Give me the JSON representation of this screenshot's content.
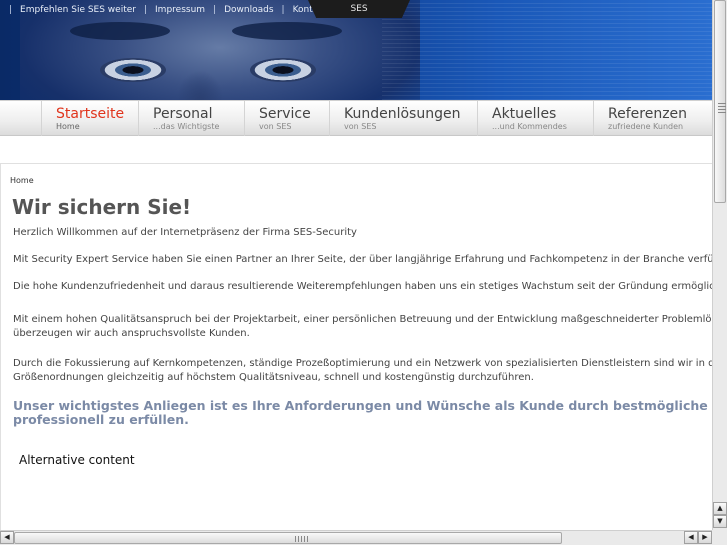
{
  "toplinks": {
    "sep": "|",
    "items": [
      "Empfehlen Sie SES weiter",
      "Impressum",
      "Downloads",
      "Kontakt"
    ]
  },
  "header": {
    "ses_tab": "SES"
  },
  "nav": [
    {
      "title": "Startseite",
      "sub": "Home",
      "active": true
    },
    {
      "title": "Personal",
      "sub": "...das Wichtigste"
    },
    {
      "title": "Service",
      "sub": "von SES"
    },
    {
      "title": "Kundenlösungen",
      "sub": "von SES"
    },
    {
      "title": "Aktuelles",
      "sub": "...und Kommendes"
    },
    {
      "title": "Referenzen",
      "sub": "zufriedene Kunden"
    }
  ],
  "content": {
    "breadcrumb": "Home",
    "title": "Wir sichern Sie!",
    "paragraphs": [
      "Herzlich Willkommen auf der Internetpräsenz der Firma SES-Security",
      "Mit Security Expert Service haben Sie einen Partner an Ihrer Seite, der über langjährige Erfahrung und Fachkompetenz in der Branche verfügt.",
      "Die hohe Kundenzufriedenheit und daraus resultierende Weiterempfehlungen haben uns ein stetiges Wachstum seit der Gründung ermöglicht.",
      "Mit einem hohen Qualitätsanspruch bei der Projektarbeit, einer persönlichen Betreuung und der Entwicklung maßgeschneiderter Problemlösungen",
      "überzeugen wir auch anspruchsvollste Kunden.",
      "Durch die Fokussierung auf Kernkompetenzen, ständige Prozeßoptimierung und ein Netzwerk von spezialisierten Dienstleistern sind wir in der Lage",
      "Größenordnungen gleichzeitig auf höchstem Qualitätsniveau, schnell und kostengünstig durchzuführen."
    ],
    "highlight_line1": "Unser wichtigstes Anliegen ist es Ihre Anforderungen und Wünsche als Kunde durch bestmögliche Sicherheitslösungen",
    "highlight_line2": "professionell zu erfüllen.",
    "alt_content": "Alternative content"
  },
  "scrollbars": {
    "up_arrow": "▲",
    "down_arrow": "▼",
    "left_arrow": "◀",
    "right_arrow": "▶"
  }
}
